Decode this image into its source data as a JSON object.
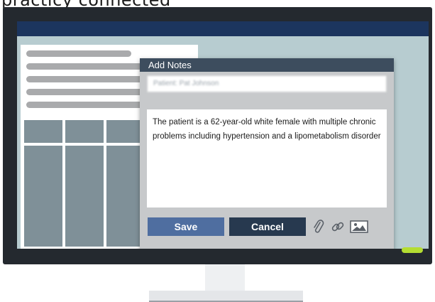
{
  "caption": {
    "text": "practicy connected"
  },
  "dialog": {
    "title": "Add Notes",
    "patient_field": "Patient: Pat Johnson",
    "notes_text": "The patient is a 62-year-old white female with multiple chronic problems including hypertension and a lipometabolism disorder",
    "save_label": "Save",
    "cancel_label": "Cancel",
    "icons": [
      "paperclip-icon",
      "link-icon",
      "image-icon"
    ]
  },
  "colors": {
    "screen_header": "#1c355e",
    "screen_background": "#b7ccd0",
    "dialog_titlebar": "#3d4d5e",
    "save_button": "#4f6ea0",
    "cancel_button": "#27394f",
    "power_led": "#b4dd32"
  }
}
